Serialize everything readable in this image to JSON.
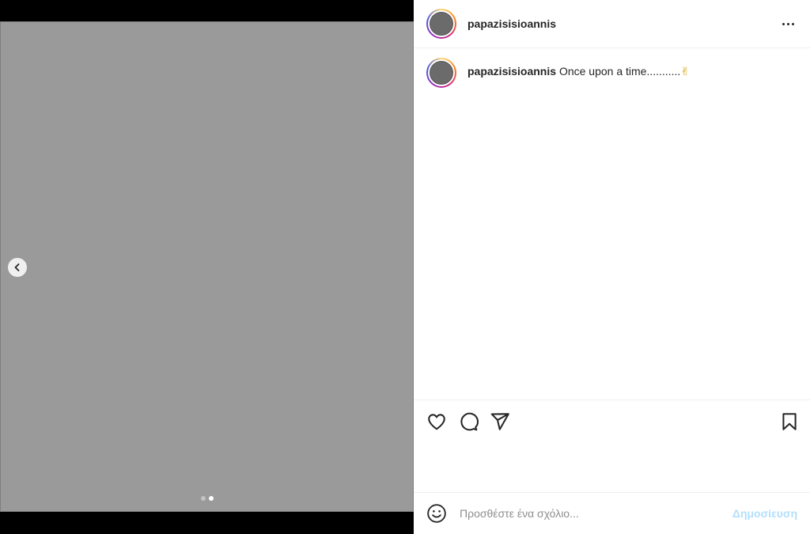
{
  "post": {
    "username": "papazisisioannis",
    "caption_text": "Once upon a time...........",
    "caption_emoji": "✌",
    "media_placeholder_label": "",
    "carousel": {
      "total": 2,
      "active": 2
    }
  },
  "header": {
    "more_icon": "more-horizontal-icon"
  },
  "actions": {
    "like_icon": "heart-icon",
    "comment_icon": "comment-icon",
    "share_icon": "send-icon",
    "save_icon": "bookmark-icon"
  },
  "comment_box": {
    "placeholder": "Προσθέστε ένα σχόλιο...",
    "post_label": "Δημοσίευση",
    "emoji_icon": "smiley-icon"
  },
  "colors": {
    "post_button_disabled": "#b2dffc",
    "text": "#262626",
    "placeholder": "#8e8e8e",
    "divider": "#efefef"
  }
}
